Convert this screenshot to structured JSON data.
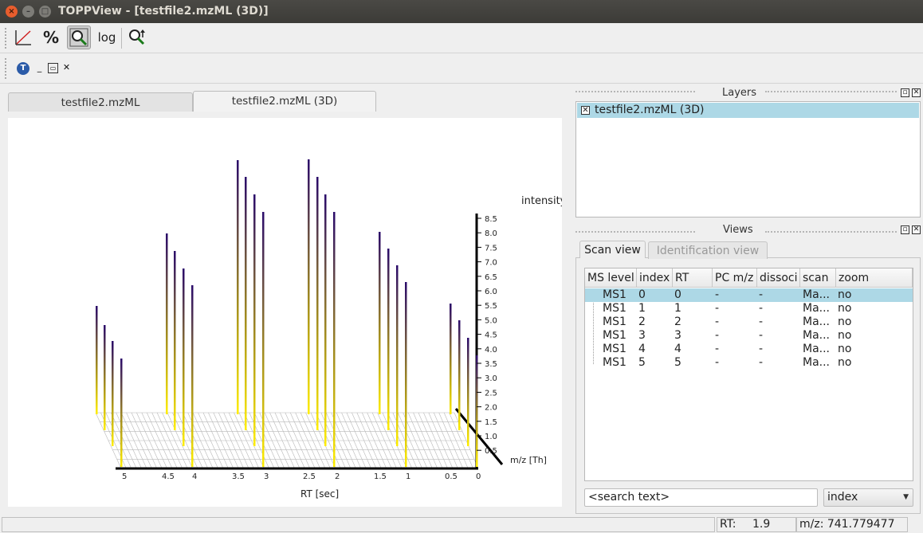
{
  "window": {
    "title": "TOPPView - [testfile2.mzML (3D)]"
  },
  "toolbar": {
    "buttons": [
      {
        "icon": "linear-scale-icon",
        "label": ""
      },
      {
        "icon": "percent-icon",
        "label": "%"
      },
      {
        "icon": "zoom-search-icon",
        "label": ""
      },
      {
        "icon": "log-icon",
        "label": "log"
      },
      {
        "icon": "zoom-range-icon",
        "label": ""
      }
    ]
  },
  "tabs": [
    {
      "label": "testfile2.mzML",
      "active": false
    },
    {
      "label": "testfile2.mzML (3D)",
      "active": true
    }
  ],
  "plot": {
    "y_axis_label": "intensity",
    "y_ticks": [
      "8.5",
      "8.0",
      "7.5",
      "7.0",
      "6.5",
      "6.0",
      "5.5",
      "5.0",
      "4.5",
      "4.0",
      "3.5",
      "3.0",
      "2.5",
      "2.0",
      "1.5",
      "1.0",
      "0.5"
    ],
    "rt_ticks": [
      "5",
      "4.5",
      "4",
      "3.5",
      "3",
      "2.5",
      "2",
      "1.5",
      "1",
      "0.5",
      "0"
    ],
    "x_axis_label": "RT [sec]",
    "mz_axis_label": "m/z [Th]"
  },
  "layers": {
    "title": "Layers",
    "items": [
      {
        "label": "testfile2.mzML (3D)",
        "checked": true
      }
    ]
  },
  "views": {
    "title": "Views",
    "tabs": [
      "Scan view",
      "Identification view"
    ],
    "columns": [
      "MS level",
      "index",
      "RT",
      "PC m/z",
      "dissoci",
      "scan",
      "zoom"
    ],
    "rows": [
      [
        "MS1",
        "0",
        "0",
        "-",
        "-",
        "Ma...",
        "no"
      ],
      [
        "MS1",
        "1",
        "1",
        "-",
        "-",
        "Ma...",
        "no"
      ],
      [
        "MS1",
        "2",
        "2",
        "-",
        "-",
        "Ma...",
        "no"
      ],
      [
        "MS1",
        "3",
        "3",
        "-",
        "-",
        "Ma...",
        "no"
      ],
      [
        "MS1",
        "4",
        "4",
        "-",
        "-",
        "Ma...",
        "no"
      ],
      [
        "MS1",
        "5",
        "5",
        "-",
        "-",
        "Ma...",
        "no"
      ]
    ],
    "search_placeholder": "<search text>",
    "search_field": "index"
  },
  "status": {
    "rt_label": "RT:",
    "rt_value": "1.9",
    "mz": "m/z: 741.779477"
  }
}
